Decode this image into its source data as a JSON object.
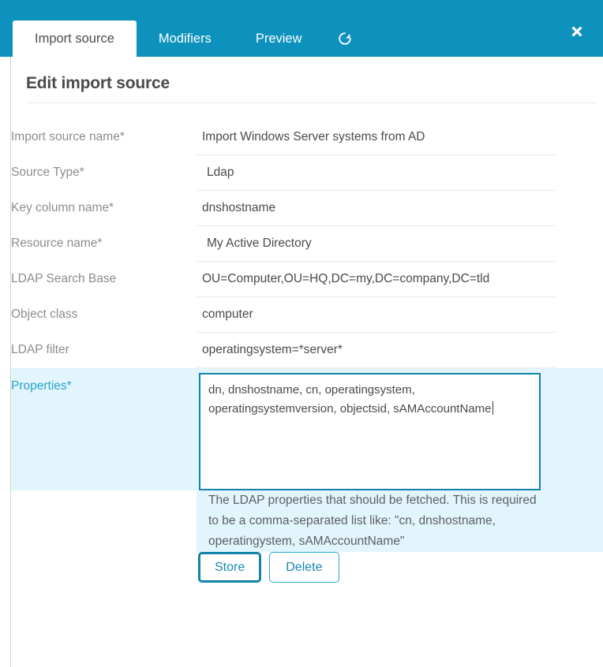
{
  "window": {
    "accent_color": "#0d91bd",
    "highlight_bg": "#e3f5fc",
    "link_color": "#27a4cc"
  },
  "tabs": [
    {
      "label": "Import source",
      "active": true
    },
    {
      "label": "Modifiers",
      "active": false
    },
    {
      "label": "Preview",
      "active": false
    }
  ],
  "header": {
    "refresh_icon": "refresh-icon",
    "close_icon": "close-icon"
  },
  "page": {
    "title": "Edit import source"
  },
  "form": {
    "fields": [
      {
        "label": "Import source name*",
        "value": "Import Windows Server systems from AD",
        "kind": "text"
      },
      {
        "label": "Source Type*",
        "value": "Ldap",
        "kind": "select"
      },
      {
        "label": "Key column name*",
        "value": "dnshostname",
        "kind": "text"
      },
      {
        "label": "Resource name*",
        "value": "My Active Directory",
        "kind": "select"
      },
      {
        "label": "LDAP Search Base",
        "value": "OU=Computer,OU=HQ,DC=my,DC=company,DC=tld",
        "kind": "text"
      },
      {
        "label": "Object class",
        "value": "computer",
        "kind": "text"
      },
      {
        "label": "LDAP filter",
        "value": "operatingsystem=*server*",
        "kind": "text"
      }
    ],
    "properties": {
      "label": "Properties*",
      "value": "dn, dnshostname, cn, operatingsystem, operatingsystemversion, objectsid, sAMAccountName",
      "help": "The LDAP properties that should be fetched. This is required to be a comma-separated list like: \"cn, dnshostname, operatingystem, sAMAccountName\""
    }
  },
  "actions": {
    "store_label": "Store",
    "delete_label": "Delete"
  }
}
